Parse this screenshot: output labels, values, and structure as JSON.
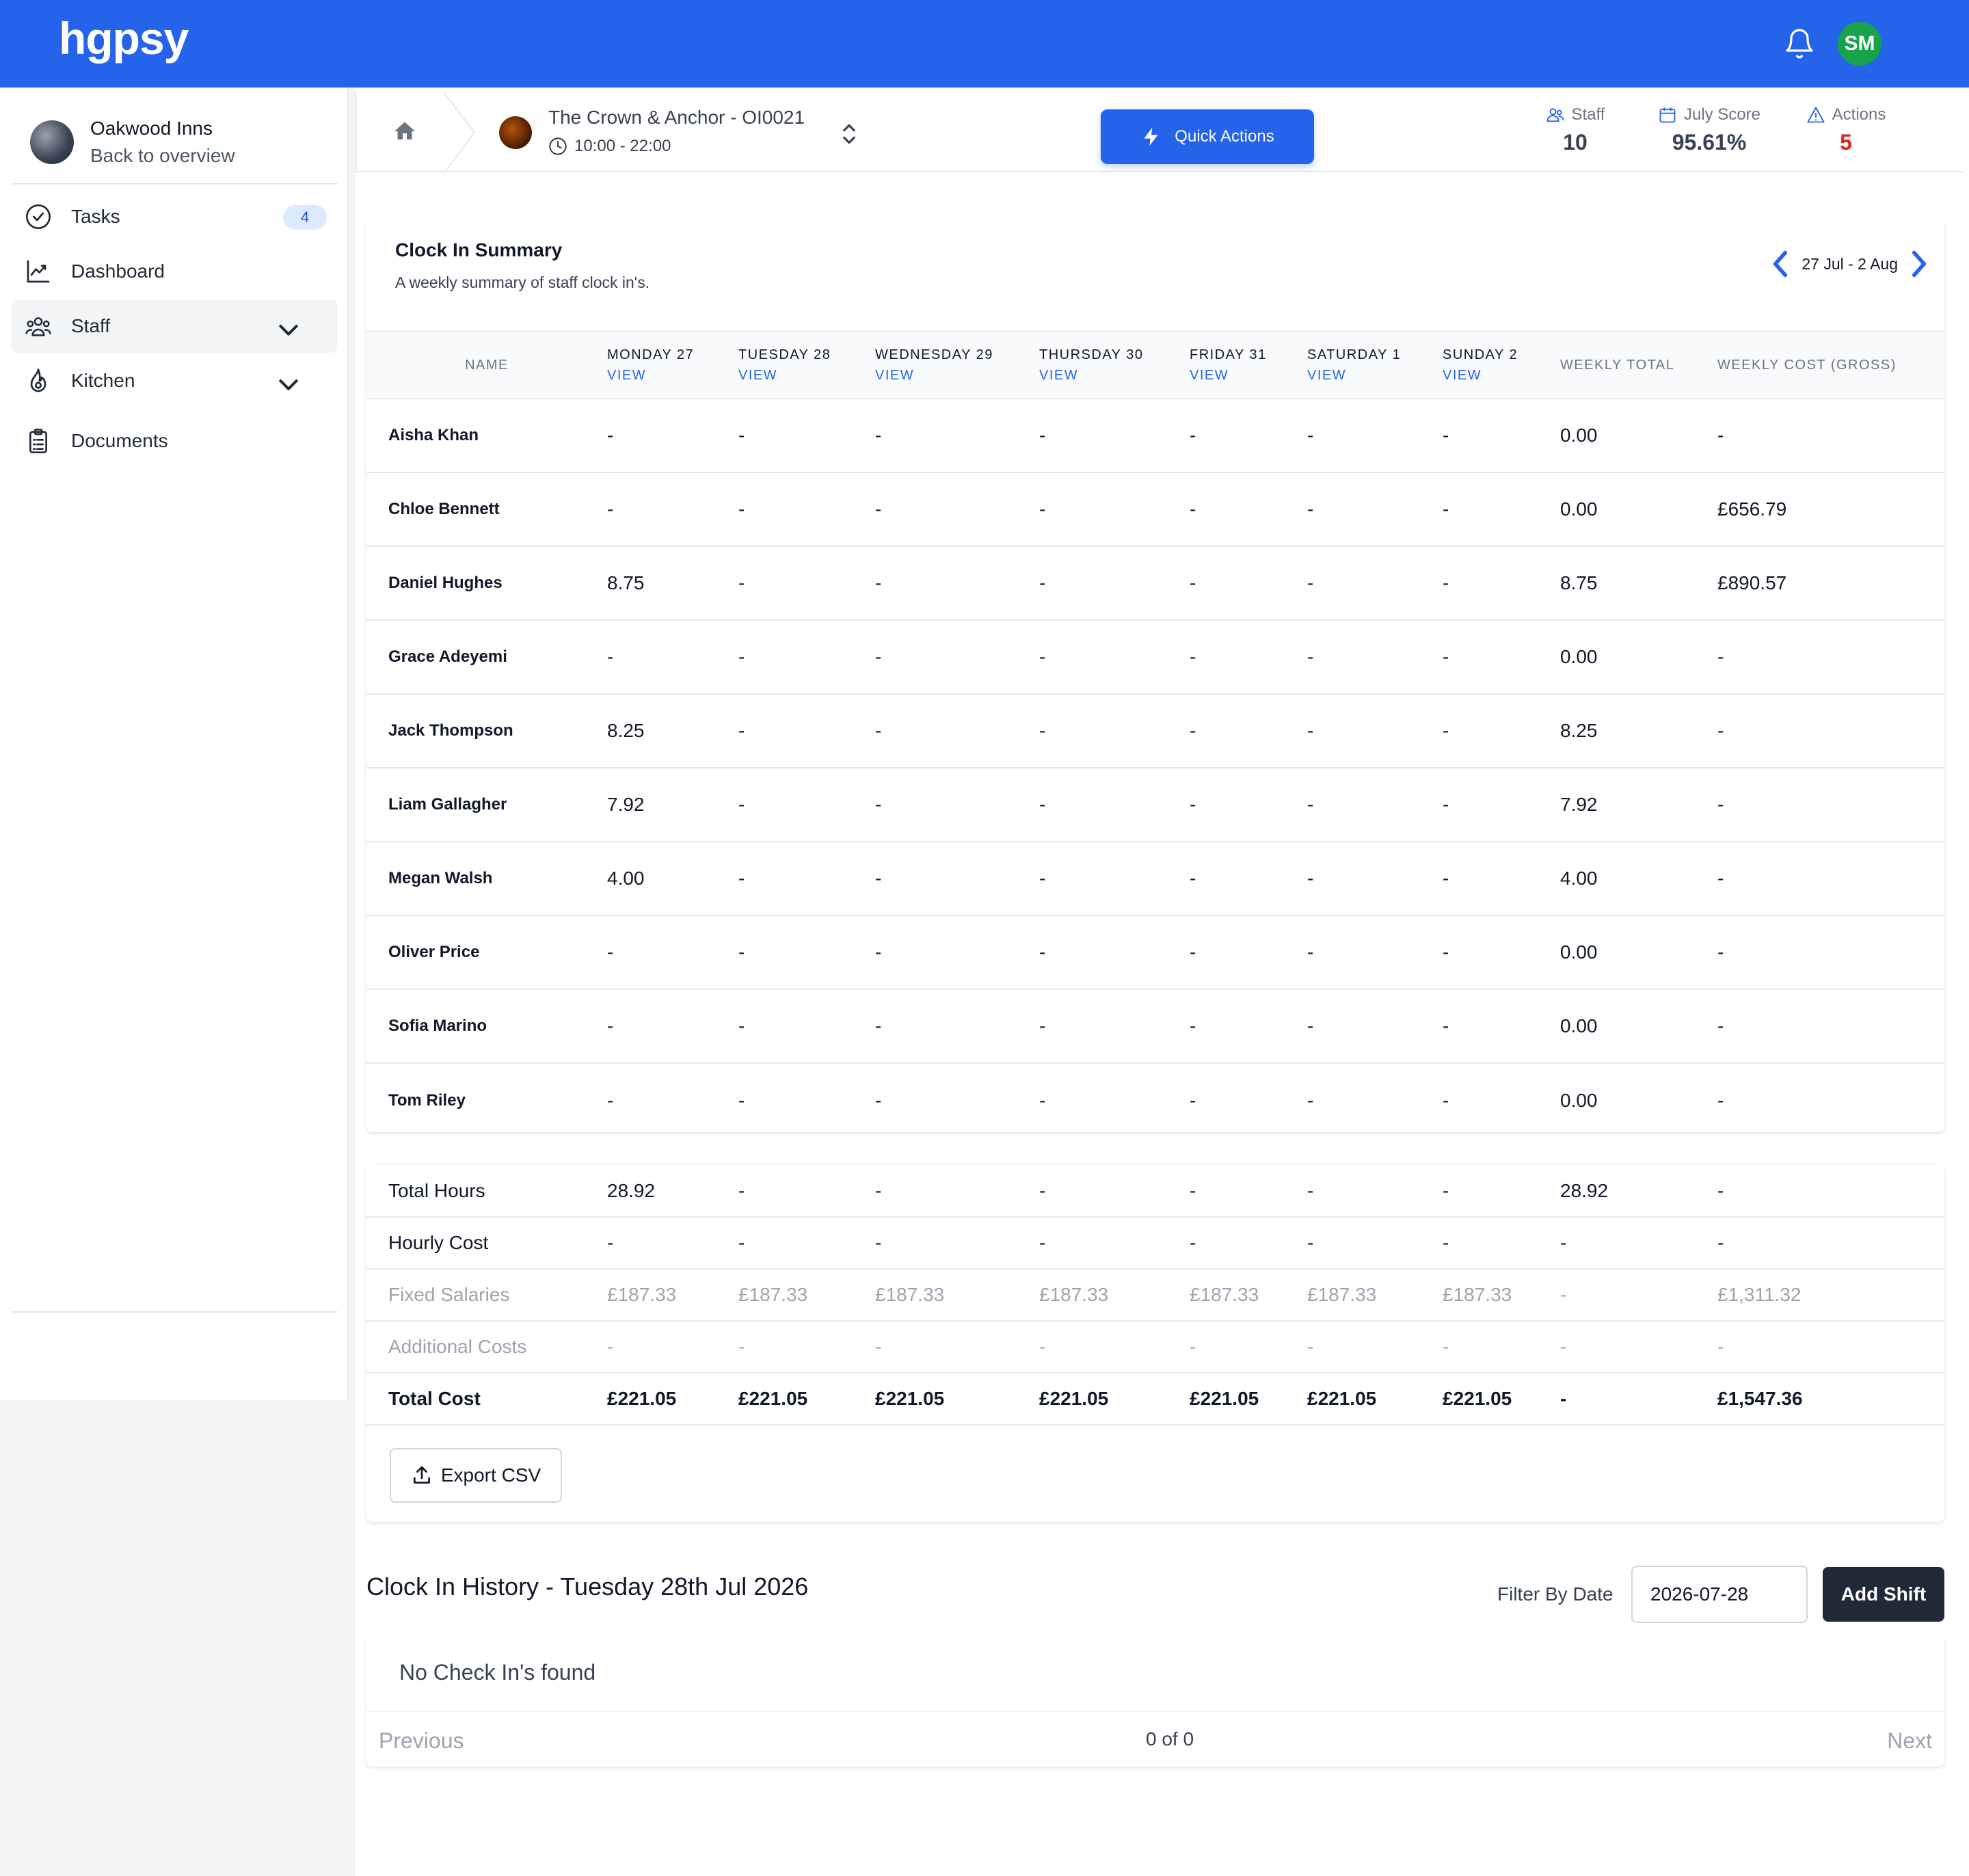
{
  "app": {
    "logo": "hgpsy",
    "user_initials": "SM"
  },
  "sidebar": {
    "org_name": "Oakwood Inns",
    "back_label": "Back to overview",
    "items": [
      {
        "label": "Tasks",
        "badge": "4"
      },
      {
        "label": "Dashboard"
      },
      {
        "label": "Staff"
      },
      {
        "label": "Kitchen"
      },
      {
        "label": "Documents"
      }
    ]
  },
  "venue": {
    "name": "The Crown & Anchor - OI0021",
    "hours": "10:00 - 22:00",
    "quick_actions": "Quick Actions",
    "stats": {
      "staff_label": "Staff",
      "staff_value": "10",
      "score_label": "July Score",
      "score_value": "95.61%",
      "actions_label": "Actions",
      "actions_value": "5"
    }
  },
  "summary": {
    "title": "Clock In Summary",
    "subtitle": "A weekly summary of staff clock in's.",
    "week_range": "27 Jul - 2 Aug",
    "columns": {
      "name": "NAME",
      "days": [
        "MONDAY 27",
        "TUESDAY 28",
        "WEDNESDAY 29",
        "THURSDAY 30",
        "FRIDAY 31",
        "SATURDAY 1",
        "SUNDAY 2"
      ],
      "view": "VIEW",
      "weekly_total": "WEEKLY TOTAL",
      "weekly_cost": "WEEKLY COST (GROSS)"
    },
    "rows": [
      {
        "name": "Aisha Khan",
        "days": [
          "-",
          "-",
          "-",
          "-",
          "-",
          "-",
          "-"
        ],
        "total": "0.00",
        "cost": "-"
      },
      {
        "name": "Chloe Bennett",
        "days": [
          "-",
          "-",
          "-",
          "-",
          "-",
          "-",
          "-"
        ],
        "total": "0.00",
        "cost": "£656.79"
      },
      {
        "name": "Daniel Hughes",
        "days": [
          "8.75",
          "-",
          "-",
          "-",
          "-",
          "-",
          "-"
        ],
        "total": "8.75",
        "cost": "£890.57"
      },
      {
        "name": "Grace Adeyemi",
        "days": [
          "-",
          "-",
          "-",
          "-",
          "-",
          "-",
          "-"
        ],
        "total": "0.00",
        "cost": "-"
      },
      {
        "name": "Jack Thompson",
        "days": [
          "8.25",
          "-",
          "-",
          "-",
          "-",
          "-",
          "-"
        ],
        "total": "8.25",
        "cost": "-"
      },
      {
        "name": "Liam Gallagher",
        "days": [
          "7.92",
          "-",
          "-",
          "-",
          "-",
          "-",
          "-"
        ],
        "total": "7.92",
        "cost": "-"
      },
      {
        "name": "Megan Walsh",
        "days": [
          "4.00",
          "-",
          "-",
          "-",
          "-",
          "-",
          "-"
        ],
        "total": "4.00",
        "cost": "-"
      },
      {
        "name": "Oliver Price",
        "days": [
          "-",
          "-",
          "-",
          "-",
          "-",
          "-",
          "-"
        ],
        "total": "0.00",
        "cost": "-"
      },
      {
        "name": "Sofia Marino",
        "days": [
          "-",
          "-",
          "-",
          "-",
          "-",
          "-",
          "-"
        ],
        "total": "0.00",
        "cost": "-"
      },
      {
        "name": "Tom Riley",
        "days": [
          "-",
          "-",
          "-",
          "-",
          "-",
          "-",
          "-"
        ],
        "total": "0.00",
        "cost": "-"
      }
    ]
  },
  "totals": {
    "rows": [
      {
        "label": "Total Hours",
        "days": [
          "28.92",
          "-",
          "-",
          "-",
          "-",
          "-",
          "-"
        ],
        "total": "28.92",
        "cost": "-",
        "style": "normal"
      },
      {
        "label": "Hourly Cost",
        "days": [
          "-",
          "-",
          "-",
          "-",
          "-",
          "-",
          "-"
        ],
        "total": "-",
        "cost": "-",
        "style": "normal"
      },
      {
        "label": "Fixed Salaries",
        "days": [
          "£187.33",
          "£187.33",
          "£187.33",
          "£187.33",
          "£187.33",
          "£187.33",
          "£187.33"
        ],
        "total": "-",
        "cost": "£1,311.32",
        "style": "muted"
      },
      {
        "label": "Additional Costs",
        "days": [
          "-",
          "-",
          "-",
          "-",
          "-",
          "-",
          "-"
        ],
        "total": "-",
        "cost": "-",
        "style": "muted"
      },
      {
        "label": "Total Cost",
        "days": [
          "£221.05",
          "£221.05",
          "£221.05",
          "£221.05",
          "£221.05",
          "£221.05",
          "£221.05"
        ],
        "total": "-",
        "cost": "£1,547.36",
        "style": "bold"
      }
    ],
    "export_label": "Export CSV"
  },
  "history": {
    "title": "Clock In History - Tuesday 28th Jul 2026",
    "filter_label": "Filter By Date",
    "filter_value": "2026-07-28",
    "add_shift": "Add Shift",
    "empty": "No Check In's found",
    "previous": "Previous",
    "count": "0 of 0",
    "next": "Next"
  },
  "colors": {
    "primary": "#2563eb",
    "danger": "#dc2626",
    "avatar": "#16a34a"
  }
}
